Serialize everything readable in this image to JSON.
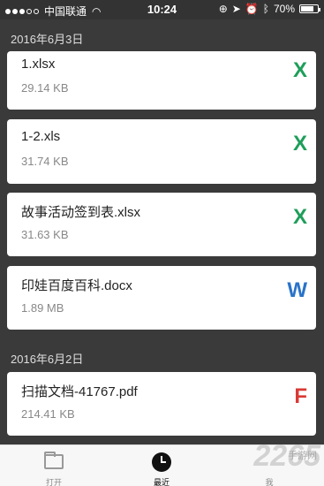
{
  "status_bar": {
    "carrier": "中国联通",
    "time": "10:24",
    "battery": "70%"
  },
  "sections": [
    {
      "date": "2016年6月3日",
      "files": [
        {
          "name": "1.xlsx",
          "size": "29.14 KB",
          "type_letter": "X",
          "type_color": "#1e9e5a"
        },
        {
          "name": "1-2.xls",
          "size": "31.74 KB",
          "type_letter": "X",
          "type_color": "#1e9e5a"
        },
        {
          "name": "故事活动签到表.xlsx",
          "size": "31.63 KB",
          "type_letter": "X",
          "type_color": "#1e9e5a"
        },
        {
          "name": "印娃百度百科.docx",
          "size": "1.89 MB",
          "type_letter": "W",
          "type_color": "#2a73c9"
        }
      ]
    },
    {
      "date": "2016年6月2日",
      "files": [
        {
          "name": "扫描文档-41767.pdf",
          "size": "214.41 KB",
          "type_letter": "F",
          "type_color": "#d83a34"
        }
      ]
    }
  ],
  "tab_bar": {
    "tabs": [
      {
        "label": "打开",
        "icon": "folder-icon"
      },
      {
        "label": "最近",
        "icon": "clock-icon"
      },
      {
        "label": "我",
        "icon": "person-icon"
      }
    ],
    "active_index": 1
  },
  "watermark": {
    "text": "2265",
    "sub": "手游网"
  }
}
